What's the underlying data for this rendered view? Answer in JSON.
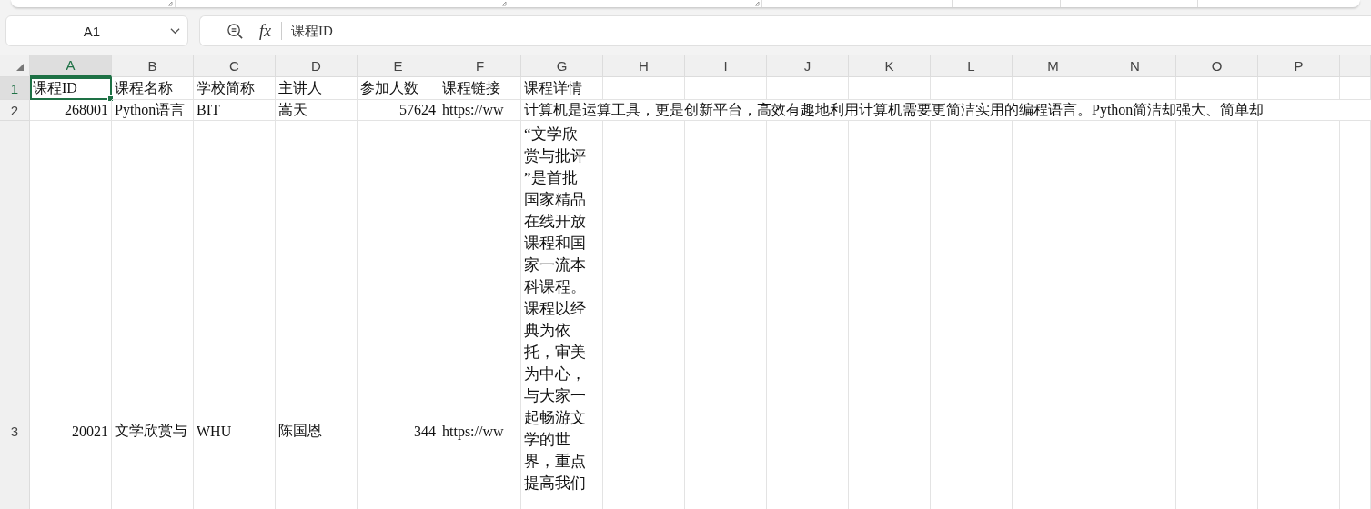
{
  "name_box": {
    "value": "A1"
  },
  "formula_bar": {
    "function_label": "fx",
    "value": "课程ID"
  },
  "columns": [
    {
      "label": "A",
      "selected": true
    },
    {
      "label": "B",
      "selected": false
    },
    {
      "label": "C",
      "selected": false
    },
    {
      "label": "D",
      "selected": false
    },
    {
      "label": "E",
      "selected": false
    },
    {
      "label": "F",
      "selected": false
    },
    {
      "label": "G",
      "selected": false
    },
    {
      "label": "H",
      "selected": false
    },
    {
      "label": "I",
      "selected": false
    },
    {
      "label": "J",
      "selected": false
    },
    {
      "label": "K",
      "selected": false
    },
    {
      "label": "L",
      "selected": false
    },
    {
      "label": "M",
      "selected": false
    },
    {
      "label": "N",
      "selected": false
    },
    {
      "label": "O",
      "selected": false
    },
    {
      "label": "P",
      "selected": false
    }
  ],
  "rows": [
    {
      "header": "1",
      "selected": true,
      "cells": [
        {
          "kind": "text",
          "text": "课程ID",
          "selected": true
        },
        {
          "kind": "text",
          "text": "课程名称",
          "selected": false
        },
        {
          "kind": "text",
          "text": "学校简称",
          "selected": false
        },
        {
          "kind": "text",
          "text": "主讲人",
          "selected": false
        },
        {
          "kind": "text",
          "text": "参加人数",
          "selected": false
        },
        {
          "kind": "text",
          "text": "课程链接",
          "selected": false
        },
        {
          "kind": "text",
          "text": "课程详情",
          "selected": false
        }
      ]
    },
    {
      "header": "2",
      "selected": false,
      "cells": [
        {
          "kind": "number",
          "text": "268001",
          "selected": false
        },
        {
          "kind": "text",
          "text": "Python语言",
          "selected": false
        },
        {
          "kind": "text",
          "text": "BIT",
          "selected": false
        },
        {
          "kind": "text",
          "text": "嵩天",
          "selected": false
        },
        {
          "kind": "number",
          "text": "57624",
          "selected": false
        },
        {
          "kind": "text",
          "text": "https://ww",
          "selected": false
        },
        {
          "kind": "overflow",
          "text": "计算机是运算工具，更是创新平台，高效有趣地利用计算机需要更简洁实用的编程语言。Python简洁却强大、简单却",
          "selected": false
        }
      ]
    },
    {
      "header": "3",
      "selected": false,
      "cells": [
        {
          "kind": "number",
          "text": "20021",
          "selected": false
        },
        {
          "kind": "text",
          "text": "文学欣赏与",
          "selected": false
        },
        {
          "kind": "text",
          "text": "WHU",
          "selected": false
        },
        {
          "kind": "text",
          "text": "陈国恩",
          "selected": false
        },
        {
          "kind": "number",
          "text": "344",
          "selected": false
        },
        {
          "kind": "text",
          "text": "https://ww",
          "selected": false
        },
        {
          "kind": "wrapped",
          "lines": [
            "“文学欣",
            "赏与批评",
            "”是首批",
            "国家精品",
            "在线开放",
            "课程和国",
            "家一流本",
            "科课程。",
            "课程以经",
            "典为依",
            "托，审美",
            "为中心，",
            "与大家一",
            "起畅游文",
            "学的世",
            "界，重点",
            "提高我们"
          ],
          "selected": false
        }
      ]
    }
  ]
}
